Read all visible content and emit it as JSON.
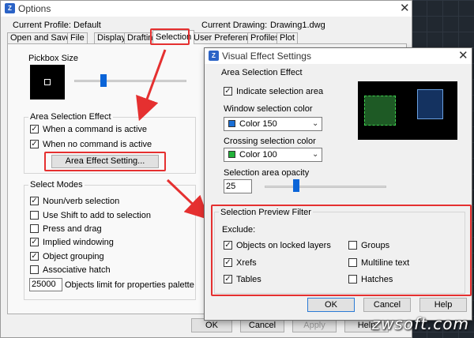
{
  "options": {
    "title": "Options",
    "current_profile_label": "Current Profile:",
    "current_profile_value": "Default",
    "current_drawing_label": "Current Drawing:",
    "current_drawing_value": "Drawing1.dwg",
    "tabs": [
      "Open and Save",
      "File",
      "Display",
      "Drafting",
      "Selection",
      "User Preferences",
      "Profiles",
      "Plot"
    ],
    "active_tab": "Selection",
    "pickbox_size": {
      "label": "Pickbox Size",
      "level": 0.25
    },
    "area_selection_effect": {
      "label": "Area Selection Effect",
      "when_command_active": {
        "label": "When a command is active",
        "checked": true
      },
      "when_no_command_active": {
        "label": "When no command is active",
        "checked": true
      },
      "area_effect_button": "Area Effect Setting..."
    },
    "select_modes": {
      "label": "Select Modes",
      "items": [
        {
          "label": "Noun/verb selection",
          "checked": true
        },
        {
          "label": "Use Shift to add to selection",
          "checked": false
        },
        {
          "label": "Press and drag",
          "checked": false
        },
        {
          "label": "Implied windowing",
          "checked": true
        },
        {
          "label": "Object grouping",
          "checked": true
        },
        {
          "label": "Associative hatch",
          "checked": false
        }
      ],
      "objects_limit_value": "25000",
      "objects_limit_label": "Objects limit for properties palette"
    },
    "buttons": {
      "ok": "OK",
      "cancel": "Cancel",
      "apply": "Apply",
      "help": "Help"
    }
  },
  "visual_effect_settings": {
    "title": "Visual Effect Settings",
    "area_selection_effect_label": "Area Selection Effect",
    "indicate_selection_area": {
      "label": "Indicate selection area",
      "checked": true
    },
    "window_selection_color": {
      "label": "Window selection color",
      "value": "Color 150",
      "swatch": "#1a6fd6"
    },
    "crossing_selection_color": {
      "label": "Crossing selection color",
      "value": "Color 100",
      "swatch": "#22b23a"
    },
    "selection_area_opacity": {
      "label": "Selection area opacity",
      "value": "25",
      "level": 0.25
    },
    "preview_colors": {
      "background": "#000000",
      "crossing": "#1e5a25",
      "crossing_border": "#3fd04f",
      "window": "#143260",
      "window_border": "#6aa0e0"
    },
    "preview_filter": {
      "label": "Selection Preview Filter",
      "exclude_label": "Exclude:",
      "objects_on_locked_layers": {
        "label": "Objects on locked layers",
        "checked": true
      },
      "xrefs": {
        "label": "Xrefs",
        "checked": true
      },
      "tables": {
        "label": "Tables",
        "checked": true
      },
      "groups": {
        "label": "Groups",
        "checked": false
      },
      "multiline_text": {
        "label": "Multiline text",
        "checked": false
      },
      "hatches": {
        "label": "Hatches",
        "checked": false
      }
    },
    "buttons": {
      "ok": "OK",
      "cancel": "Cancel",
      "help": "Help"
    }
  },
  "watermark": "zwsoft.com",
  "highlight_color": "#e53030",
  "checkmark_glyph": "✓"
}
